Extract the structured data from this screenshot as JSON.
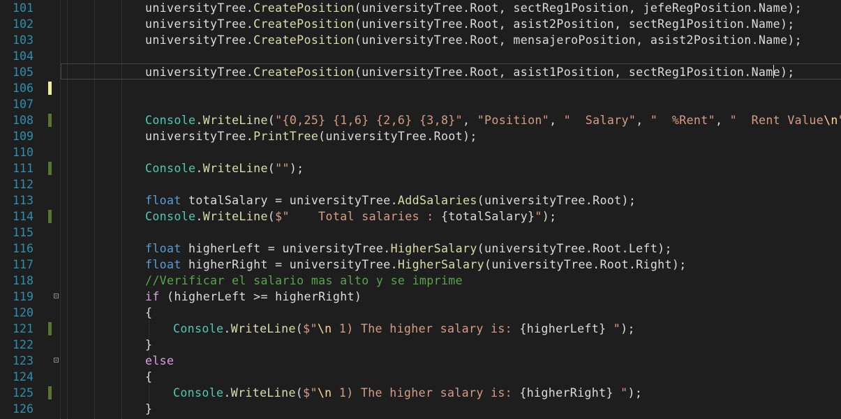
{
  "editor": {
    "lines": [
      {
        "number": "101",
        "indent": 1,
        "marker": "none",
        "fold": false,
        "tokens": [
          [
            "plain",
            "universityTree."
          ],
          [
            "method",
            "CreatePosition"
          ],
          [
            "plain",
            "(universityTree.Root, sectReg1Position, jefeRegPosition.Name);"
          ]
        ]
      },
      {
        "number": "102",
        "indent": 1,
        "marker": "none",
        "fold": false,
        "tokens": [
          [
            "plain",
            "universityTree."
          ],
          [
            "method",
            "CreatePosition"
          ],
          [
            "plain",
            "(universityTree.Root, asist2Position, sectReg1Position.Name);"
          ]
        ]
      },
      {
        "number": "103",
        "indent": 1,
        "marker": "none",
        "fold": false,
        "tokens": [
          [
            "plain",
            "universityTree."
          ],
          [
            "method",
            "CreatePosition"
          ],
          [
            "plain",
            "(universityTree.Root, mensajeroPosition, asist2Position.Name);"
          ]
        ]
      },
      {
        "number": "104",
        "indent": 1,
        "marker": "none",
        "fold": false,
        "tokens": []
      },
      {
        "number": "105",
        "indent": 1,
        "marker": "none",
        "fold": false,
        "tokens": [
          [
            "plain",
            "universityTree."
          ],
          [
            "method",
            "CreatePosition"
          ],
          [
            "plain",
            "(universityTree.Root, asist1Position, sectReg1Position.Name);"
          ]
        ]
      },
      {
        "number": "106",
        "indent": 1,
        "marker": "unsaved",
        "fold": false,
        "tokens": []
      },
      {
        "number": "107",
        "indent": 1,
        "marker": "none",
        "fold": false,
        "tokens": []
      },
      {
        "number": "108",
        "indent": 1,
        "marker": "saved",
        "fold": false,
        "tokens": [
          [
            "type",
            "Console"
          ],
          [
            "plain",
            "."
          ],
          [
            "method",
            "WriteLine"
          ],
          [
            "plain",
            "("
          ],
          [
            "string",
            "\"{0,25} {1,6} {2,6} {3,8}\""
          ],
          [
            "plain",
            ", "
          ],
          [
            "string",
            "\"Position\""
          ],
          [
            "plain",
            ", "
          ],
          [
            "string",
            "\"  Salary\""
          ],
          [
            "plain",
            ", "
          ],
          [
            "string",
            "\"  %Rent\""
          ],
          [
            "plain",
            ", "
          ],
          [
            "string",
            "\"  Rent Value"
          ],
          [
            "escape",
            "\\n"
          ],
          [
            "string",
            "\""
          ],
          [
            "plain",
            ");"
          ]
        ]
      },
      {
        "number": "109",
        "indent": 1,
        "marker": "none",
        "fold": false,
        "tokens": [
          [
            "plain",
            "universityTree."
          ],
          [
            "method",
            "PrintTree"
          ],
          [
            "plain",
            "(universityTree.Root);"
          ]
        ]
      },
      {
        "number": "110",
        "indent": 1,
        "marker": "none",
        "fold": false,
        "tokens": []
      },
      {
        "number": "111",
        "indent": 1,
        "marker": "saved",
        "fold": false,
        "tokens": [
          [
            "type",
            "Console"
          ],
          [
            "plain",
            "."
          ],
          [
            "method",
            "WriteLine"
          ],
          [
            "plain",
            "("
          ],
          [
            "string",
            "\"\""
          ],
          [
            "plain",
            ");"
          ]
        ]
      },
      {
        "number": "112",
        "indent": 1,
        "marker": "none",
        "fold": false,
        "tokens": []
      },
      {
        "number": "113",
        "indent": 1,
        "marker": "none",
        "fold": false,
        "tokens": [
          [
            "keyword",
            "float"
          ],
          [
            "plain",
            " totalSalary = universityTree."
          ],
          [
            "method",
            "AddSalaries"
          ],
          [
            "plain",
            "(universityTree.Root);"
          ]
        ]
      },
      {
        "number": "114",
        "indent": 1,
        "marker": "saved",
        "fold": false,
        "tokens": [
          [
            "type",
            "Console"
          ],
          [
            "plain",
            "."
          ],
          [
            "method",
            "WriteLine"
          ],
          [
            "plain",
            "("
          ],
          [
            "string",
            "$\"    Total salaries : "
          ],
          [
            "plain",
            "{totalSalary}"
          ],
          [
            "string",
            "\""
          ],
          [
            "plain",
            ");"
          ]
        ]
      },
      {
        "number": "115",
        "indent": 1,
        "marker": "none",
        "fold": false,
        "tokens": []
      },
      {
        "number": "116",
        "indent": 1,
        "marker": "none",
        "fold": false,
        "tokens": [
          [
            "keyword",
            "float"
          ],
          [
            "plain",
            " higherLeft = universityTree."
          ],
          [
            "method",
            "HigherSalary"
          ],
          [
            "plain",
            "(universityTree.Root.Left);"
          ]
        ]
      },
      {
        "number": "117",
        "indent": 1,
        "marker": "none",
        "fold": false,
        "tokens": [
          [
            "keyword",
            "float"
          ],
          [
            "plain",
            " higherRight = universityTree."
          ],
          [
            "method",
            "HigherSalary"
          ],
          [
            "plain",
            "(universityTree.Root.Right);"
          ]
        ]
      },
      {
        "number": "118",
        "indent": 1,
        "marker": "none",
        "fold": false,
        "tokens": [
          [
            "comment",
            "//Verificar el salario mas alto y se imprime"
          ]
        ]
      },
      {
        "number": "119",
        "indent": 1,
        "marker": "none",
        "fold": true,
        "tokens": [
          [
            "control",
            "if"
          ],
          [
            "plain",
            " (higherLeft >= higherRight)"
          ]
        ]
      },
      {
        "number": "120",
        "indent": 1,
        "marker": "none",
        "fold": false,
        "tokens": [
          [
            "plain",
            "{"
          ]
        ]
      },
      {
        "number": "121",
        "indent": 2,
        "marker": "saved",
        "fold": false,
        "tokens": [
          [
            "type",
            "Console"
          ],
          [
            "plain",
            "."
          ],
          [
            "method",
            "WriteLine"
          ],
          [
            "plain",
            "("
          ],
          [
            "string",
            "$\""
          ],
          [
            "escape",
            "\\n"
          ],
          [
            "string",
            " 1) The higher salary is: "
          ],
          [
            "plain",
            "{higherLeft}"
          ],
          [
            "string",
            " \""
          ],
          [
            "plain",
            ");"
          ]
        ]
      },
      {
        "number": "122",
        "indent": 1,
        "marker": "none",
        "fold": false,
        "tokens": [
          [
            "plain",
            "}"
          ]
        ]
      },
      {
        "number": "123",
        "indent": 1,
        "marker": "none",
        "fold": true,
        "tokens": [
          [
            "control",
            "else"
          ]
        ]
      },
      {
        "number": "124",
        "indent": 1,
        "marker": "none",
        "fold": false,
        "tokens": [
          [
            "plain",
            "{"
          ]
        ]
      },
      {
        "number": "125",
        "indent": 2,
        "marker": "saved",
        "fold": false,
        "tokens": [
          [
            "type",
            "Console"
          ],
          [
            "plain",
            "."
          ],
          [
            "method",
            "WriteLine"
          ],
          [
            "plain",
            "("
          ],
          [
            "string",
            "$\""
          ],
          [
            "escape",
            "\\n"
          ],
          [
            "string",
            " 1) The higher salary is: "
          ],
          [
            "plain",
            "{higherRight}"
          ],
          [
            "string",
            " \""
          ],
          [
            "plain",
            ");"
          ]
        ]
      },
      {
        "number": "126",
        "indent": 1,
        "marker": "none",
        "fold": false,
        "tokens": [
          [
            "plain",
            "}"
          ]
        ]
      }
    ],
    "current_line": "105"
  },
  "colors": {
    "background": "#1e1e1e",
    "line_number": "#2b91af",
    "plain": "#dcdcdc",
    "method": "#dcdcaa",
    "type": "#4ec9b0",
    "string": "#d69d85",
    "keyword": "#569cd6",
    "control": "#d8a0df",
    "comment": "#57a64a",
    "saved_marker": "#577430",
    "unsaved_marker": "#efef91"
  }
}
